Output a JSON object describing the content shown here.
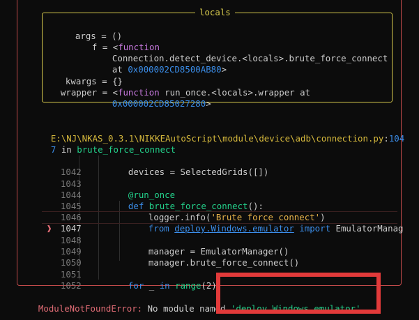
{
  "locals": {
    "title": "locals",
    "rows": [
      {
        "key": "args",
        "value": "()"
      },
      {
        "key": "f",
        "value_prefix": "<",
        "value_keyword": "function",
        "value_rest": ""
      },
      {
        "key": "",
        "value": "Connection.detect_device.<locals>.brute_force_connect"
      },
      {
        "key": "",
        "value_prefix": "at ",
        "value_addr": "0x000002CD8500AB80",
        "value_suffix": ">"
      },
      {
        "key": "kwargs",
        "value": "{}"
      },
      {
        "key": "wrapper",
        "value_prefix": "<",
        "value_keyword": "function",
        "value_rest": " run_once.<locals>.wrapper at"
      },
      {
        "key": "",
        "value_addr": "0x000002CD85027280",
        "value_suffix": ">"
      }
    ]
  },
  "location": {
    "path": "E:\\NJ\\NKAS_0.3.1\\NIKKEAutoScript\\module\\device\\adb\\connection.py",
    "colon": ":",
    "line_a": "104",
    "line_b": "7",
    "in_word": " in ",
    "func": "brute_force_connect"
  },
  "code": {
    "marker": "❱",
    "lines": [
      {
        "num": "1042",
        "text": "devices = SelectedGrids([])"
      },
      {
        "num": "1043",
        "text": ""
      },
      {
        "num": "1044",
        "decorator": "@run_once"
      },
      {
        "num": "1045",
        "def_kw": "def",
        "def_name": "brute_force_connect",
        "def_rest": "():"
      },
      {
        "num": "1046",
        "text": "logger.info(",
        "str": "'Brute force connect'",
        "after": ")"
      },
      {
        "num": "1047",
        "from_kw": "from",
        "module": "deploy.Windows.emulator",
        "import_kw": "import",
        "rest": "EmulatorManag"
      },
      {
        "num": "1048",
        "text": ""
      },
      {
        "num": "1049",
        "text": "manager = EmulatorManager()"
      },
      {
        "num": "1050",
        "text": "manager.brute_force_connect()"
      },
      {
        "num": "1051",
        "text": ""
      },
      {
        "num": "1052",
        "for_kw": "for",
        "for_var": "_",
        "in_kw": "in",
        "for_call": "range",
        "for_arg": "(2):"
      }
    ]
  },
  "error": {
    "name": "ModuleNotFoundError:",
    "message": " No module named ",
    "module": "'deploy.Windows.emulator'"
  }
}
